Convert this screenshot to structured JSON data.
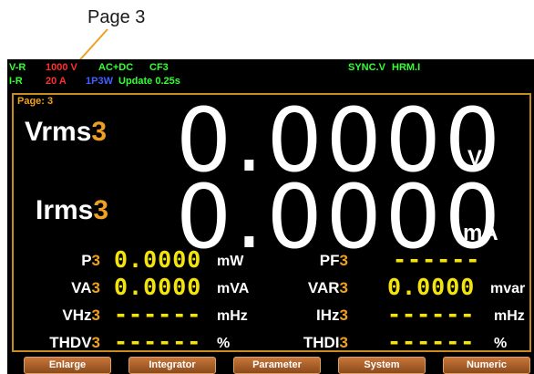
{
  "callout": {
    "label": "Page 3"
  },
  "status_bar": {
    "vr_label": "V-R",
    "vr_value": "1000 V",
    "coupling": "AC+DC",
    "crest_factor": "CF3",
    "sync": "SYNC.V",
    "harmonic": "HRM.I",
    "ir_label": "I-R",
    "ir_value": "20 A",
    "wiring": "1P3W",
    "update": "Update 0.25s"
  },
  "page_label": "Page: 3",
  "main": {
    "vrms": {
      "label": "Vrms",
      "index": "3",
      "value": "0.0000",
      "unit": "V"
    },
    "irms": {
      "label": "Irms",
      "index": "3",
      "value": "0.0000",
      "unit": "mA"
    }
  },
  "params": [
    {
      "label": "P",
      "index": "3",
      "value": "0.0000",
      "unit": "mW"
    },
    {
      "label": "PF",
      "index": "3",
      "value": "------",
      "unit": ""
    },
    {
      "label": "VA",
      "index": "3",
      "value": "0.0000",
      "unit": "mVA"
    },
    {
      "label": "VAR",
      "index": "3",
      "value": "0.0000",
      "unit": "mvar"
    },
    {
      "label": "VHz",
      "index": "3",
      "value": "------",
      "unit": "mHz"
    },
    {
      "label": "IHz",
      "index": "3",
      "value": "------",
      "unit": "mHz"
    },
    {
      "label": "THDV",
      "index": "3",
      "value": "------",
      "unit": "%"
    },
    {
      "label": "THDI",
      "index": "3",
      "value": "------",
      "unit": "%"
    }
  ],
  "softkeys": [
    "Enlarge",
    "Integrator",
    "Parameter",
    "System",
    "Numeric"
  ],
  "colors": {
    "accent_orange": "#f0a020",
    "value_yellow": "#f4e40a",
    "status_green": "#33ff33",
    "status_red": "#ff3030",
    "status_blue": "#4060ff"
  }
}
